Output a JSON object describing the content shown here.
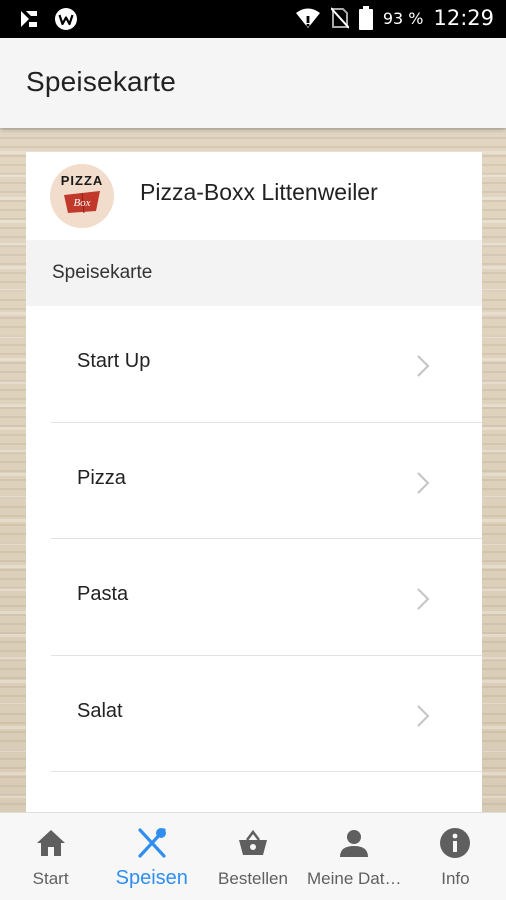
{
  "status_bar": {
    "battery_percent": "93 %",
    "time": "12:29",
    "icons": [
      "app-notification-icon",
      "w-app-icon",
      "wifi-icon",
      "no-sim-icon",
      "battery-icon"
    ]
  },
  "appbar": {
    "title": "Speisekarte"
  },
  "restaurant": {
    "logo_text": "PIZZA",
    "logo_sub": "Box",
    "name": "Pizza-Boxx Littenweiler"
  },
  "section": {
    "label": "Speisekarte"
  },
  "menu": {
    "items": [
      {
        "label": "Start Up"
      },
      {
        "label": "Pizza"
      },
      {
        "label": "Pasta"
      },
      {
        "label": "Salat"
      },
      {
        "label": ""
      }
    ]
  },
  "bottom_nav": {
    "items": [
      {
        "label": "Start",
        "icon": "home-icon",
        "active": false
      },
      {
        "label": "Speisen",
        "icon": "fork-knife-icon",
        "active": true
      },
      {
        "label": "Bestellen",
        "icon": "basket-icon",
        "active": false
      },
      {
        "label": "Meine Dat…",
        "icon": "person-icon",
        "active": false
      },
      {
        "label": "Info",
        "icon": "info-icon",
        "active": false
      }
    ]
  },
  "colors": {
    "accent": "#2f8ef0",
    "inactive": "#5f5f5f",
    "appbar": "#f5f5f5"
  }
}
